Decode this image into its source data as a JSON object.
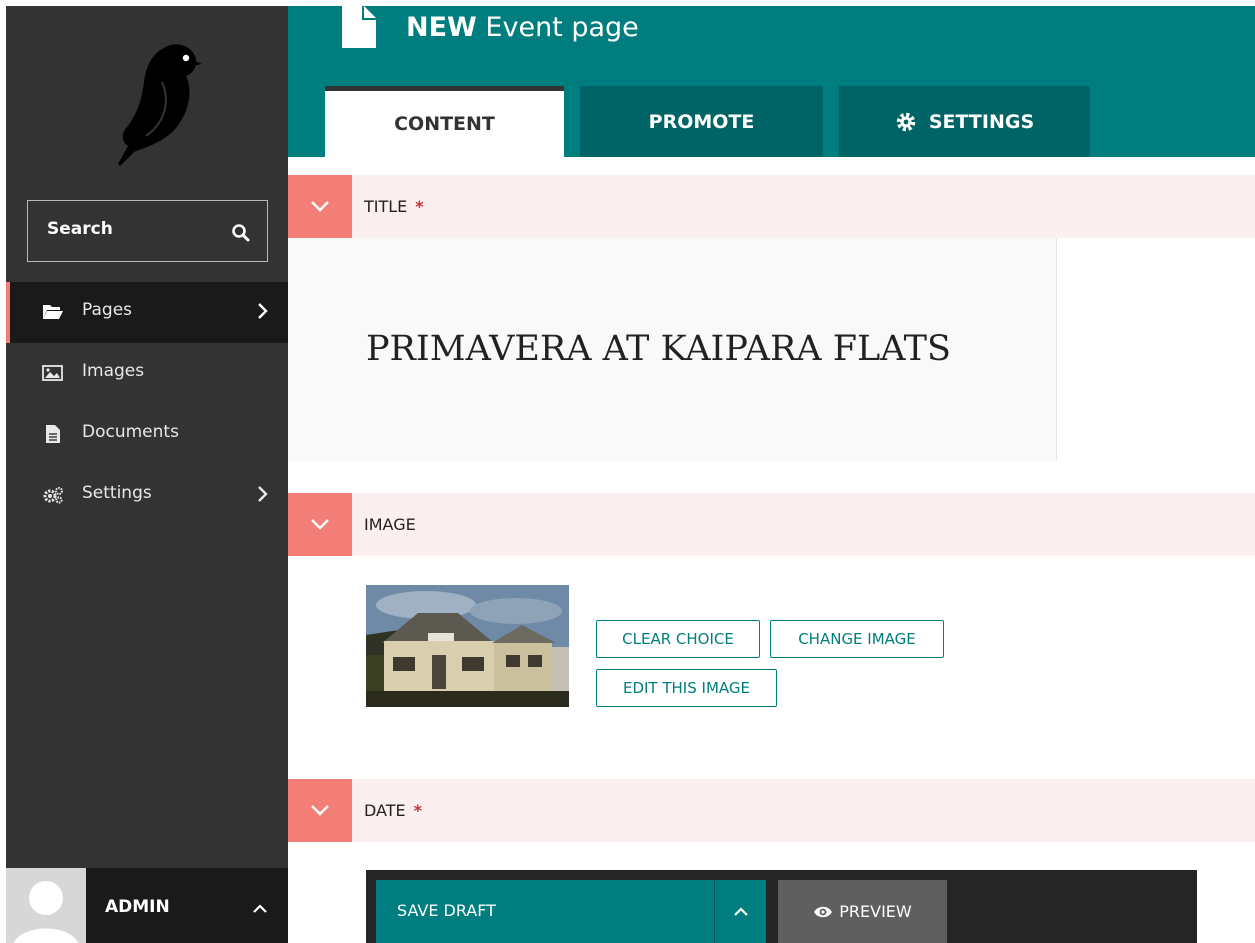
{
  "sidebar": {
    "search": {
      "label": "Search"
    },
    "nav": [
      {
        "label": "Pages",
        "icon": "folder-open-icon",
        "active": true,
        "has_children": true
      },
      {
        "label": "Images",
        "icon": "image-icon",
        "active": false,
        "has_children": false
      },
      {
        "label": "Documents",
        "icon": "document-icon",
        "active": false,
        "has_children": false
      },
      {
        "label": "Settings",
        "icon": "cogs-icon",
        "active": false,
        "has_children": true
      }
    ],
    "account": {
      "name": "ADMIN"
    }
  },
  "header": {
    "title_prefix": "NEW",
    "title_rest": "Event page",
    "tabs": [
      {
        "label": "CONTENT",
        "active": true
      },
      {
        "label": "PROMOTE",
        "active": false
      },
      {
        "label": "SETTINGS",
        "active": false,
        "icon": "gear-icon"
      }
    ]
  },
  "fields": {
    "title": {
      "label": "TITLE",
      "required_mark": "*",
      "value": "PRIMAVERA AT KAIPARA FLATS"
    },
    "image": {
      "label": "IMAGE",
      "buttons": {
        "clear": "CLEAR CHOICE",
        "change": "CHANGE IMAGE",
        "edit": "EDIT THIS IMAGE"
      }
    },
    "date": {
      "label": "DATE",
      "required_mark": "*"
    }
  },
  "actions": {
    "save_draft": "SAVE DRAFT",
    "preview": "PREVIEW"
  },
  "colors": {
    "teal": "#007d7e",
    "teal_dark": "#006366",
    "sidebar": "#333333",
    "accent": "#f37e77",
    "field_header_bg": "#fcefef",
    "required": "#cd3238"
  }
}
